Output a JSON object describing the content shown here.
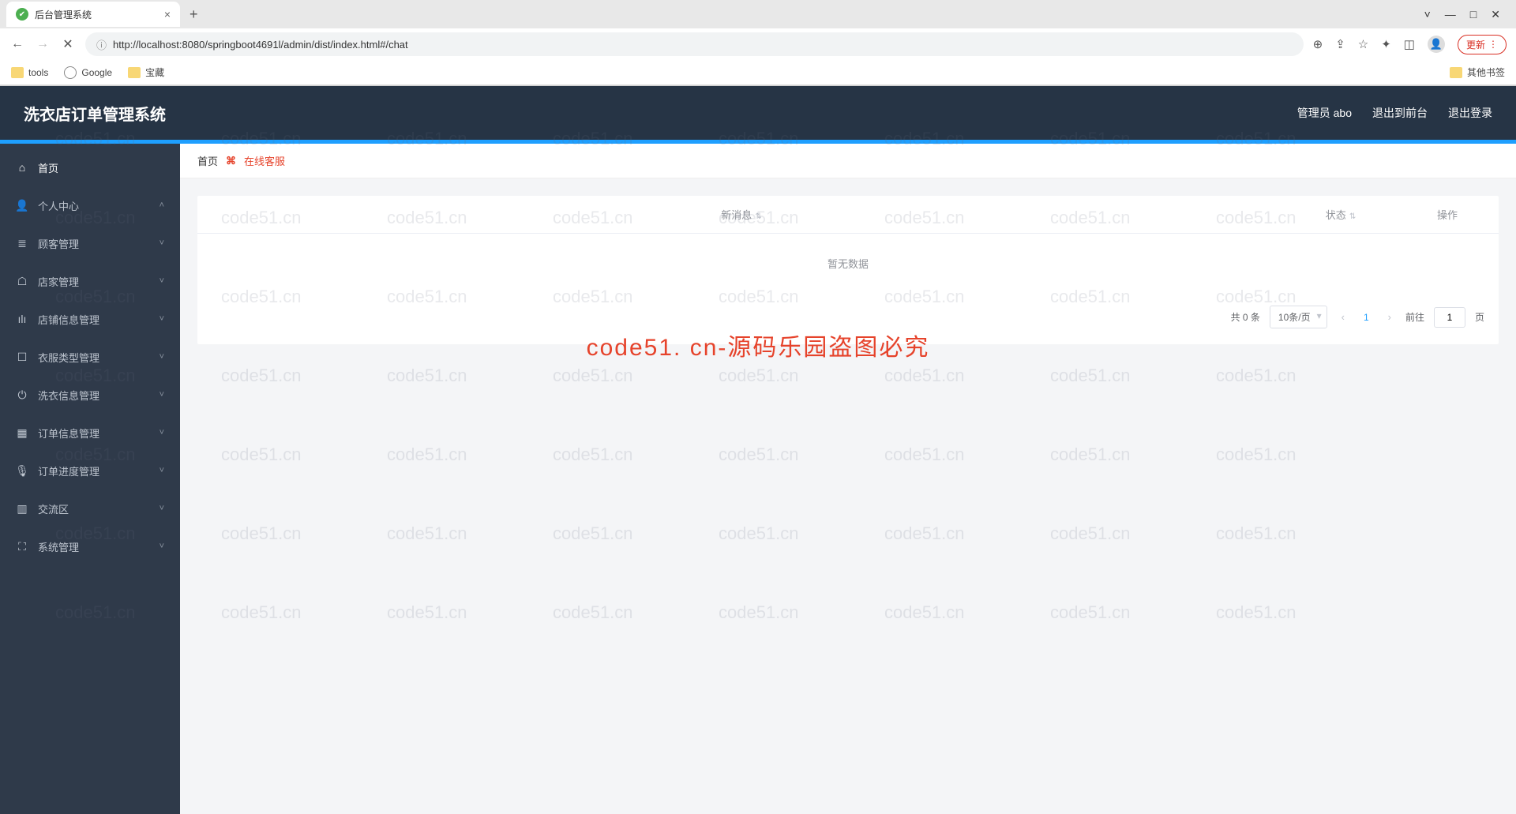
{
  "browser": {
    "tab_title": "后台管理系统",
    "url": "http://localhost:8080/springboot4691l/admin/dist/index.html#/chat",
    "info_icon": "ⓘ",
    "bookmarks": {
      "tools": "tools",
      "google": "Google",
      "treasure": "宝藏",
      "other": "其他书签"
    },
    "update": "更新"
  },
  "header": {
    "title": "洗衣店订单管理系统",
    "user": "管理员 abo",
    "to_front": "退出到前台",
    "logout": "退出登录"
  },
  "sidebar": {
    "items": [
      {
        "icon": "⌂",
        "label": "首页",
        "arrow": ""
      },
      {
        "icon": "👤",
        "label": "个人中心",
        "arrow": "˄"
      },
      {
        "icon": "≣",
        "label": "顾客管理",
        "arrow": "˅"
      },
      {
        "icon": "☖",
        "label": "店家管理",
        "arrow": "˅"
      },
      {
        "icon": "ılı",
        "label": "店铺信息管理",
        "arrow": "˅"
      },
      {
        "icon": "☐",
        "label": "衣服类型管理",
        "arrow": "˅"
      },
      {
        "icon": "⏻",
        "label": "洗衣信息管理",
        "arrow": "˅"
      },
      {
        "icon": "▦",
        "label": "订单信息管理",
        "arrow": "˅"
      },
      {
        "icon": "🎙",
        "label": "订单进度管理",
        "arrow": "˅"
      },
      {
        "icon": "▥",
        "label": "交流区",
        "arrow": "˅"
      },
      {
        "icon": "⛶",
        "label": "系统管理",
        "arrow": "˅"
      }
    ]
  },
  "crumb": {
    "home": "首页",
    "icon": "⌘",
    "current": "在线客服"
  },
  "table": {
    "cols": {
      "msg": "新消息",
      "status": "状态",
      "action": "操作"
    },
    "empty": "暂无数据"
  },
  "pager": {
    "total": "共 0 条",
    "per_page": "10条/页",
    "current": "1",
    "goto_pre": "前往",
    "goto_val": "1",
    "goto_suf": "页"
  },
  "watermark": {
    "cell": "code51.cn",
    "center": "code51. cn-源码乐园盗图必究"
  }
}
